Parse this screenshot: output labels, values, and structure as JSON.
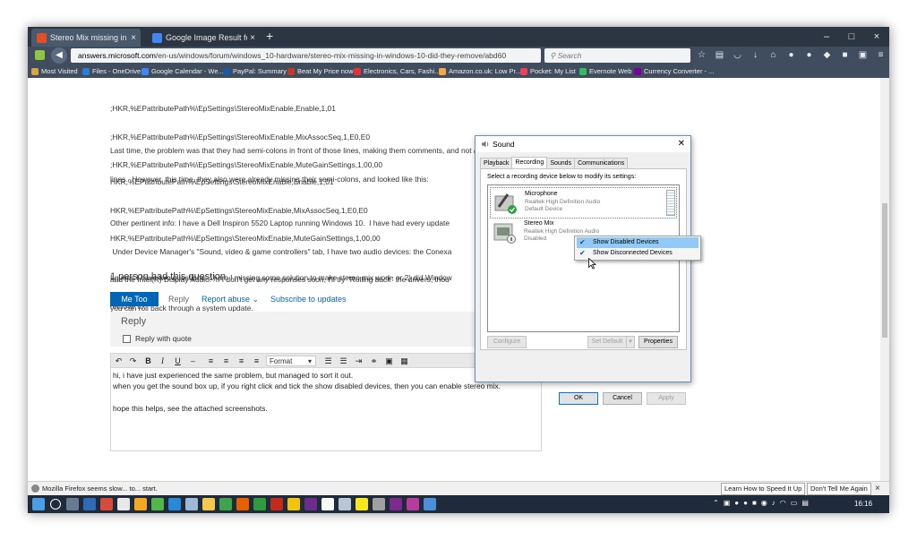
{
  "browser": {
    "tabs": [
      {
        "label": "Stereo Mix missing in Windo...",
        "close": "×"
      },
      {
        "label": "Google Image Result for h...",
        "close": "×"
      }
    ],
    "new_tab": "+",
    "window_buttons": [
      "–",
      "□",
      "×"
    ],
    "url_domain": "answers.microsoft.com",
    "url_path": "/en-us/windows/forum/windows_10-hardware/stereo-mix-missing-in-windows-10-did-they-remove/abd60",
    "search_placeholder": "Search",
    "bookmarks": [
      {
        "label": "Most Visited",
        "color": "#d9a441"
      },
      {
        "label": "Files - OneDrive",
        "color": "#2b7cd3"
      },
      {
        "label": "Google Calendar - We...",
        "color": "#4285f4"
      },
      {
        "label": "PayPal: Summary",
        "color": "#1a5aa6"
      },
      {
        "label": "Beat My Price now",
        "color": "#c23b22"
      },
      {
        "label": "Electronics, Cars, Fashi...",
        "color": "#e53238"
      },
      {
        "label": "Amazon.co.uk: Low Pr...",
        "color": "#f3a847"
      },
      {
        "label": "Pocket: My List",
        "color": "#ef4056"
      },
      {
        "label": "Evernote Web",
        "color": "#2dbe60"
      },
      {
        "label": "Currency Converter - ...",
        "color": "#7b0099"
      }
    ]
  },
  "post": {
    "code1": [
      ";HKR,%EPattributePath%\\EpSettings\\StereoMixEnable,Enable,1,01",
      ";HKR,%EPattributePath%\\EpSettings\\StereoMixEnable,MixAssocSeq,1,E0,E0",
      ";HKR,%EPattributePath%\\EpSettings\\StereoMixEnable,MuteGainSettings,1,00,00"
    ],
    "para1": [
      "Last time, the problem was that they had semi-colons in front of those lines, making them comments, and not actual",
      "lines.  However, this time, they also were already missing their semi-colons, and looked like this:"
    ],
    "code2": [
      "HKR,%EPattributePath%\\EpSettings\\StereoMixEnable,Enable,1,01",
      "HKR,%EPattributePath%\\EpSettings\\StereoMixEnable,MixAssocSeq,1,E0,E0",
      "HKR,%EPattributePath%\\EpSettings\\StereoMixEnable,MuteGainSettings,1,00,00"
    ],
    "para2": [
      "Other pertinent info: I have a Dell Inspiron 5520 Laptop running Windows 10.  I have had every update",
      " Under Device Manager's \"Sound, video & game controllers\" tab, I have two audio devices: the Conexa",
      "and the Intel(R) Display Audio.  If I don't get any responses soon, I'll try \"Rolling back\" the drivers, thou",
      "you can roll back through a system update."
    ],
    "para3": [
      "I guess I have two questions: 1) am I missing some solution to make stereo mix work, or 2) did Window",
      "remove it?"
    ],
    "question_count": "1 person had this question",
    "me_too": "Me Too",
    "reply_link": "Reply",
    "report_abuse": "Report abuse",
    "subscribe": "Subscribe to updates"
  },
  "reply": {
    "title": "Reply",
    "with_quote": "Reply with quote",
    "format_label": "Format",
    "editor_lines": [
      "hi, i have just experienced the same problem, but managed to sort it out.",
      "when you get the sound box up, if you right click and tick the show disabled devices, then you can enable stereo mix.",
      "",
      "hope this helps, see the attached screenshots."
    ]
  },
  "notification": {
    "message": "Mozilla Firefox seems slow... to... start.",
    "learn": "Learn How to Speed It Up",
    "dont_tell": "Don't Tell Me Again"
  },
  "taskbar": {
    "clock": "16:16"
  },
  "sound_dialog": {
    "title": "Sound",
    "tabs": [
      "Playback",
      "Recording",
      "Sounds",
      "Communications"
    ],
    "instruction": "Select a recording device below to modify its settings:",
    "devices": [
      {
        "name": "Microphone",
        "driver": "Realtek High Definition Audio",
        "status": "Default Device"
      },
      {
        "name": "Stereo Mix",
        "driver": "Realtek High Definition Audio",
        "status": "Disabled"
      }
    ],
    "context_menu": [
      {
        "label": "Show Disabled Devices",
        "checked": true
      },
      {
        "label": "Show Disconnected Devices",
        "checked": true
      }
    ],
    "configure": "Configure",
    "set_default": "Set Default",
    "properties": "Properties",
    "ok": "OK",
    "cancel": "Cancel",
    "apply": "Apply"
  }
}
